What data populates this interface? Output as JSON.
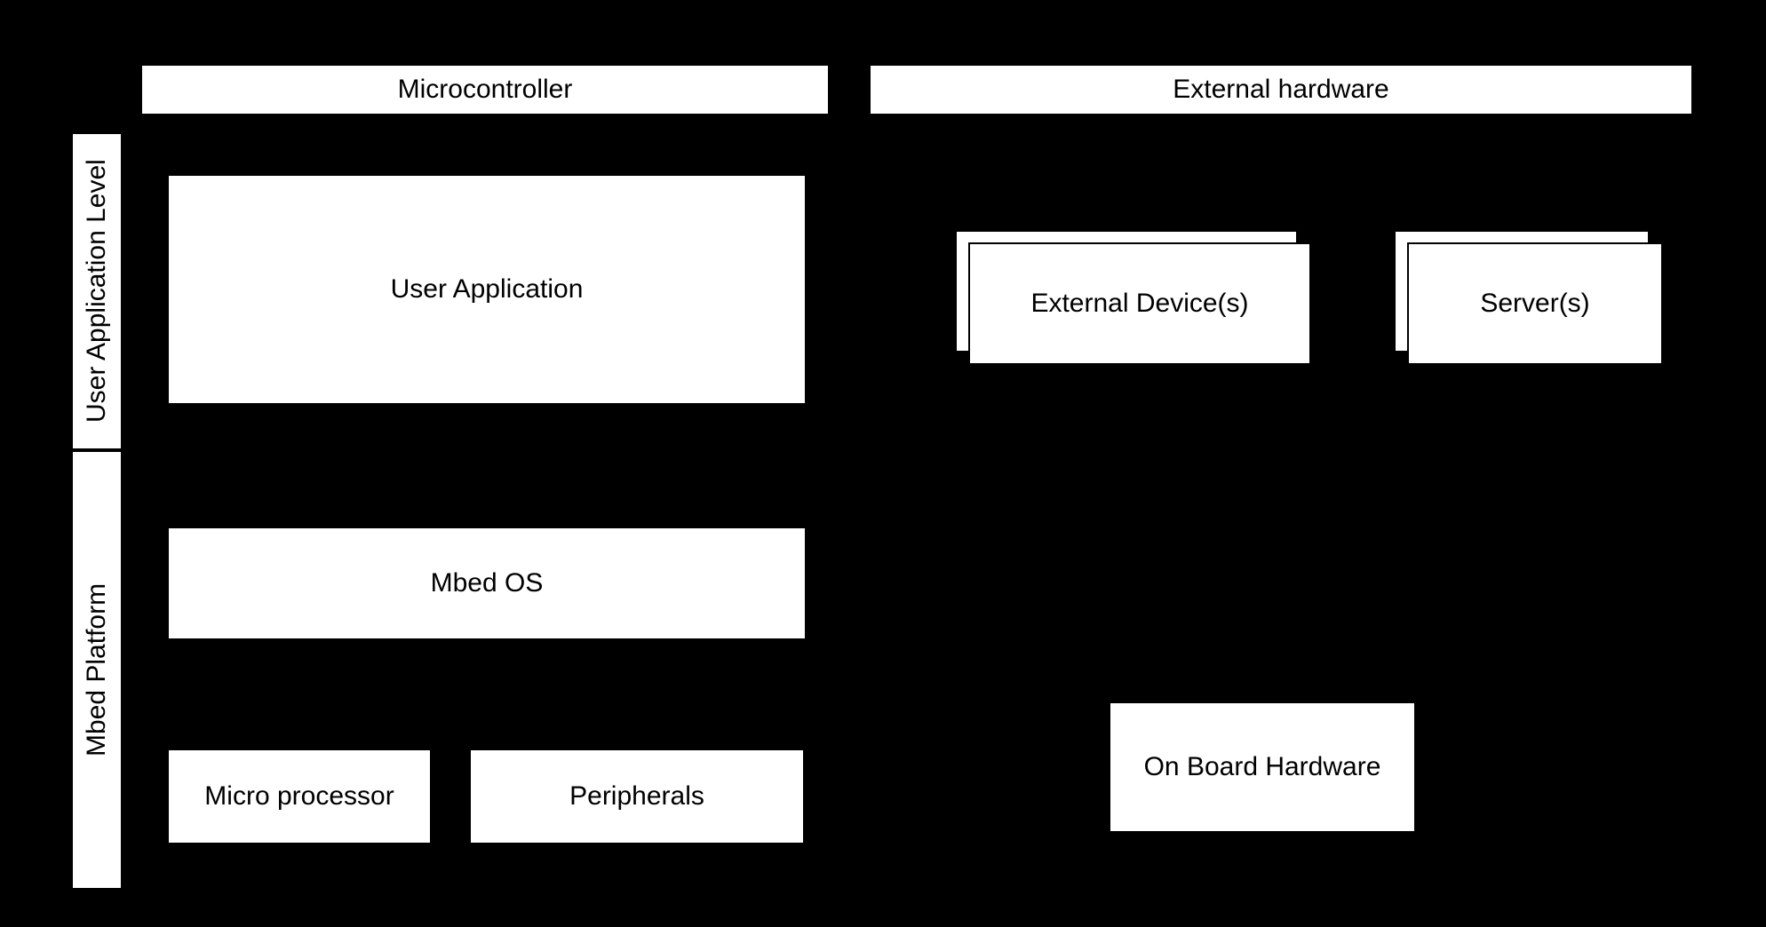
{
  "headers": {
    "microcontroller": "Microcontroller",
    "external_hardware": "External hardware"
  },
  "rows": {
    "user_app_level": "User Application Level",
    "mbed_platform": "Mbed Platform"
  },
  "blocks": {
    "user_application": "User Application",
    "external_devices": "External Device(s)",
    "servers": "Server(s)",
    "mbed_os": "Mbed OS",
    "micro_processor": "Micro processor",
    "peripherals": "Peripherals",
    "on_board_hardware": "On Board Hardware"
  }
}
